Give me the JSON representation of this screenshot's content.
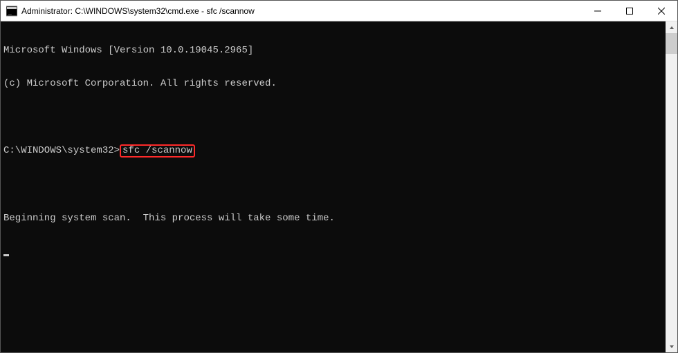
{
  "titlebar": {
    "title": "Administrator: C:\\WINDOWS\\system32\\cmd.exe - sfc  /scannow"
  },
  "terminal": {
    "line1": "Microsoft Windows [Version 10.0.19045.2965]",
    "line2": "(c) Microsoft Corporation. All rights reserved.",
    "prompt": "C:\\WINDOWS\\system32>",
    "command": "sfc /scannow",
    "status": "Beginning system scan.  This process will take some time."
  }
}
